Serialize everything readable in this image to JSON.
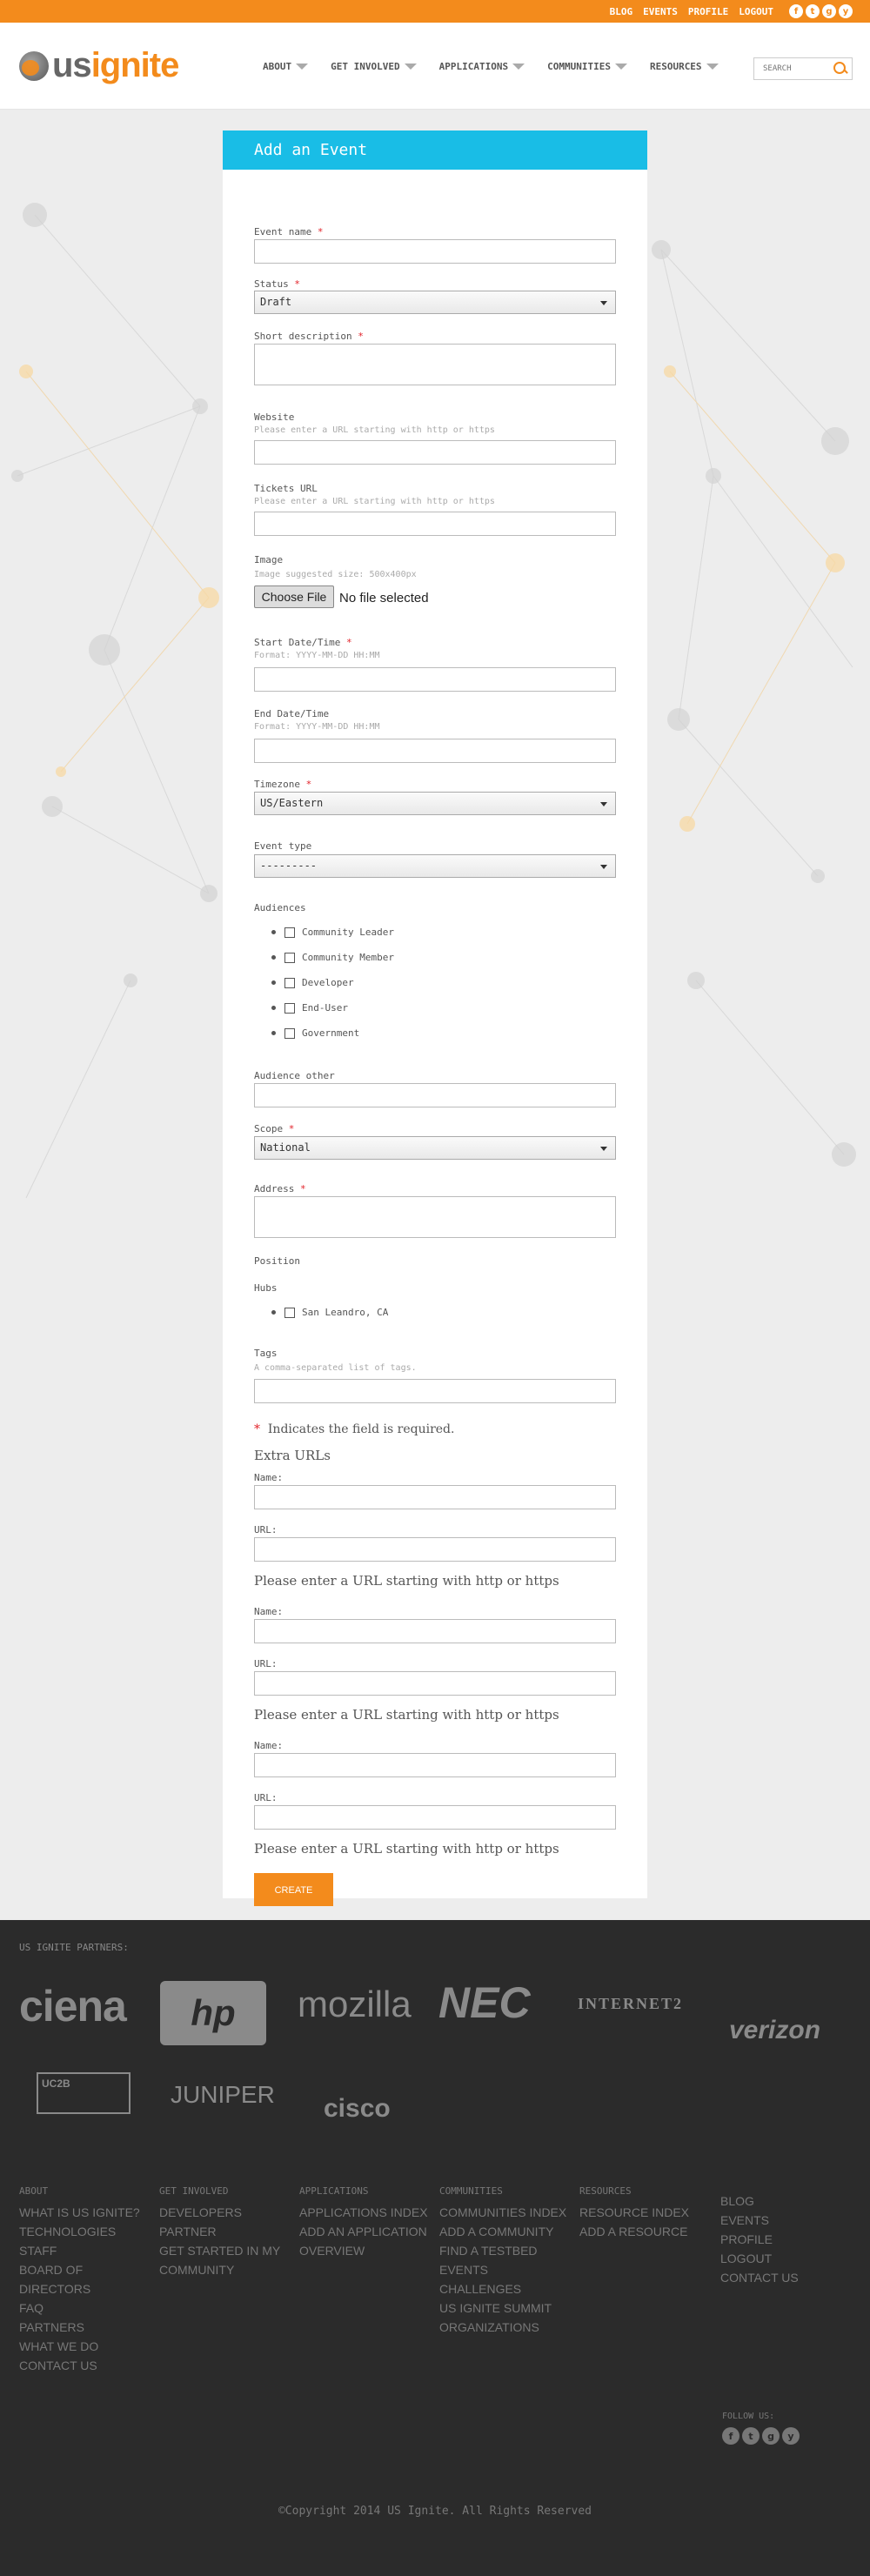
{
  "topbar": {
    "links": [
      "BLOG",
      "EVENTS",
      "PROFILE",
      "LOGOUT"
    ],
    "social": [
      "f",
      "t",
      "g",
      "y"
    ],
    "brand_color": "#f38b1c"
  },
  "header": {
    "logo_us": "us",
    "logo_ignite": "ignite",
    "nav": [
      "ABOUT",
      "GET INVOLVED",
      "APPLICATIONS",
      "COMMUNITIES",
      "RESOURCES"
    ],
    "search_placeholder": "SEARCH"
  },
  "form": {
    "title": "Add an Event",
    "event_name_label": "Event name",
    "status_label": "Status",
    "status_value": "Draft",
    "short_description_label": "Short description",
    "website_label": "Website",
    "url_help": "Please enter a URL starting with http or https",
    "tickets_label": "Tickets URL",
    "image_label": "Image",
    "image_help": "Image suggested size: 500x400px",
    "choose_file": "Choose File",
    "no_file": "No file selected",
    "start_label": "Start Date/Time",
    "date_help": "Format: YYYY-MM-DD HH:MM",
    "end_label": "End Date/Time",
    "timezone_label": "Timezone",
    "timezone_value": "US/Eastern",
    "event_type_label": "Event type",
    "event_type_value": "---------",
    "audiences_label": "Audiences",
    "audiences": [
      "Community Leader",
      "Community Member",
      "Developer",
      "End-User",
      "Government"
    ],
    "audience_other_label": "Audience other",
    "scope_label": "Scope",
    "scope_value": "National",
    "address_label": "Address",
    "position_label": "Position",
    "hubs_label": "Hubs",
    "hubs": [
      "San Leandro, CA"
    ],
    "tags_label": "Tags",
    "tags_help": "A comma-separated list of tags.",
    "required_note": "Indicates the field is required.",
    "required_mark": "*",
    "extra_urls_title": "Extra URLs",
    "name_label": "Name:",
    "url_label": "URL:",
    "extra_url_help": "Please enter a URL starting with http or https",
    "create_button": "CREATE"
  },
  "footer": {
    "partners_title": "US IGNITE PARTNERS:",
    "partners": [
      "ciena",
      "hp",
      "mozilla",
      "NEC",
      "INTERNET2",
      "verizon",
      "UC2B",
      "JUNIPER",
      "cisco"
    ],
    "columns": [
      {
        "head": "ABOUT",
        "links": [
          "WHAT IS US IGNITE?",
          "TECHNOLOGIES",
          "STAFF",
          "BOARD OF DIRECTORS",
          "FAQ",
          "PARTNERS",
          "WHAT WE DO",
          "CONTACT US"
        ]
      },
      {
        "head": "GET INVOLVED",
        "links": [
          "DEVELOPERS",
          "PARTNER",
          "GET STARTED IN MY COMMUNITY"
        ]
      },
      {
        "head": "APPLICATIONS",
        "links": [
          "APPLICATIONS INDEX",
          "ADD AN APPLICATION",
          "OVERVIEW"
        ]
      },
      {
        "head": "COMMUNITIES",
        "links": [
          "COMMUNITIES INDEX",
          "ADD A COMMUNITY",
          "FIND A TESTBED",
          "EVENTS",
          "CHALLENGES",
          "US IGNITE SUMMIT",
          "ORGANIZATIONS"
        ]
      },
      {
        "head": "RESOURCES",
        "links": [
          "RESOURCE INDEX",
          "ADD A RESOURCE"
        ]
      },
      {
        "head": "",
        "links": [
          "BLOG",
          "EVENTS",
          "PROFILE",
          "LOGOUT",
          "CONTACT US"
        ]
      }
    ],
    "follow_label": "FOLLOW US:",
    "copyright": "©Copyright 2014 US Ignite. All Rights Reserved"
  }
}
